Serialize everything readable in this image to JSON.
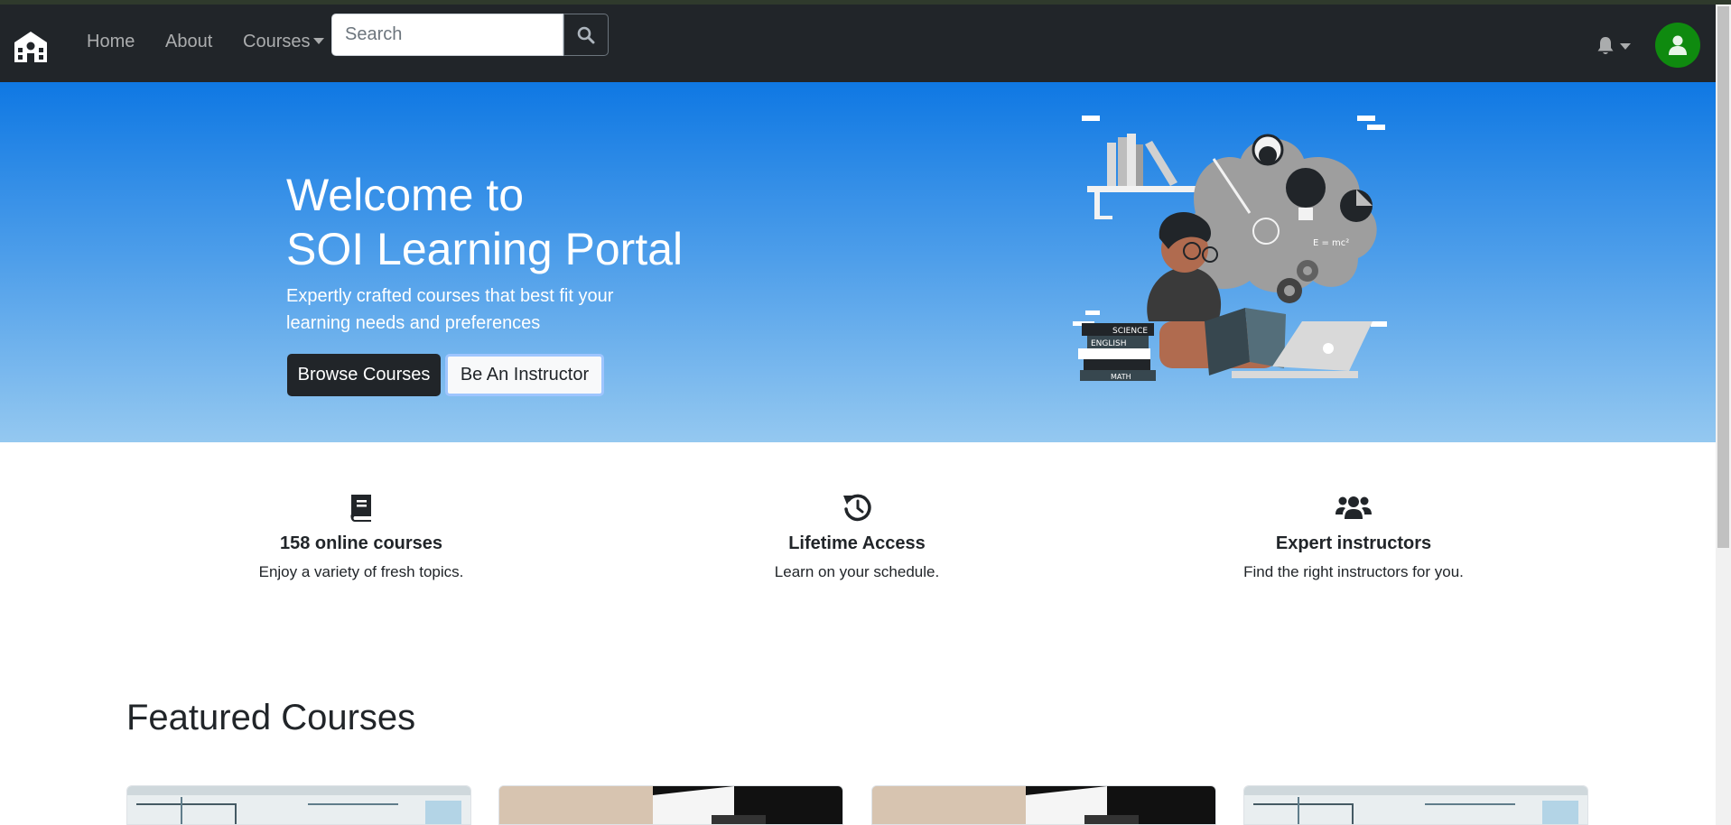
{
  "nav": {
    "brand_icon": "school-icon",
    "home": "Home",
    "about": "About",
    "courses": "Courses",
    "search_placeholder": "Search",
    "search_icon": "search-icon",
    "bell_icon": "bell-icon",
    "avatar_icon": "user-icon",
    "avatar_color": "#0f8a0f"
  },
  "hero": {
    "title_line1": "Welcome to",
    "title_line2": "SOI Learning Portal",
    "subtitle_line1": "Expertly crafted courses that best fit your",
    "subtitle_line2": "learning needs and preferences",
    "browse_label": "Browse Courses",
    "instructor_label": "Be An Instructor",
    "illustration_labels": [
      "SCIENCE",
      "ENGLISH",
      "MATH",
      "E = mc²"
    ]
  },
  "features": [
    {
      "icon": "book-icon",
      "title": "158 online courses",
      "desc": "Enjoy a variety of fresh topics."
    },
    {
      "icon": "history-icon",
      "title": "Lifetime Access",
      "desc": "Learn on your schedule."
    },
    {
      "icon": "users-icon",
      "title": "Expert instructors",
      "desc": "Find the right instructors for you."
    }
  ],
  "featured": {
    "heading": "Featured Courses"
  },
  "colors": {
    "navbar": "#212529",
    "hero_top": "#0f78e3",
    "hero_bottom": "#94c8f0"
  }
}
